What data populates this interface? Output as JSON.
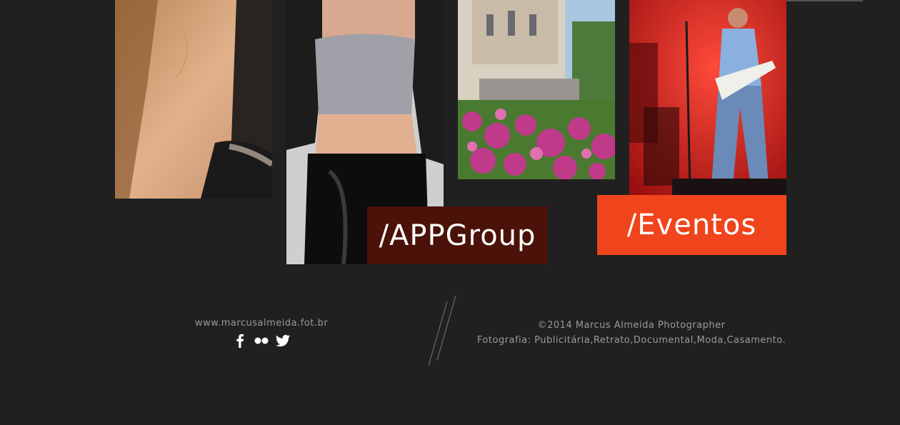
{
  "tiles": {
    "appgroup": {
      "label": "/APPGroup",
      "color": "#4a1208"
    },
    "eventos": {
      "label": "/Eventos",
      "color": "#f0441c"
    }
  },
  "footer": {
    "website": "www.marcusalmeida.fot.br",
    "social_icons": [
      "facebook-icon",
      "flickr-icon",
      "twitter-icon"
    ],
    "copyright": "©2014 Marcus Almeida Photographer",
    "services": "Fotografia: Publicitária,Retrato,Documental,Moda,Casamento."
  },
  "colors": {
    "background": "#202020",
    "footer_text": "#9a9a9a"
  }
}
